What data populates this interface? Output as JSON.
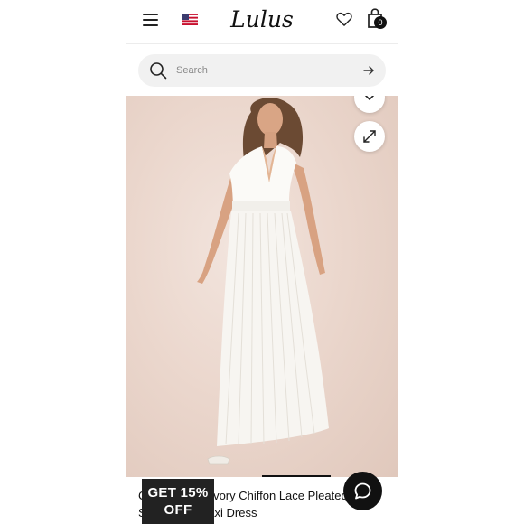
{
  "header": {
    "brand": "Lulus",
    "flag_icon": "us-flag-icon",
    "menu_icon": "hamburger-menu-icon",
    "wishlist_icon": "heart-icon",
    "bag_icon": "shopping-bag-icon",
    "bag_count": "0"
  },
  "search": {
    "placeholder": "Search",
    "submit_icon": "arrow-right-icon"
  },
  "gallery": {
    "collapse_icon": "chevron-down-icon",
    "expand_icon": "expand-arrows-icon"
  },
  "product": {
    "title": "Ca... Forever Ivory Chiffon Lace Pleated Sleeveless Maxi Dress"
  },
  "promo": {
    "line1": "GET 15%",
    "line2": "OFF"
  },
  "chat": {
    "icon": "chat-bubble-icon"
  },
  "colors": {
    "background": "#ffffff",
    "search_bg": "#f1f1f1",
    "image_bg": "#ebd7cd",
    "badge_bg": "#222222",
    "chat_bg": "#111111"
  }
}
